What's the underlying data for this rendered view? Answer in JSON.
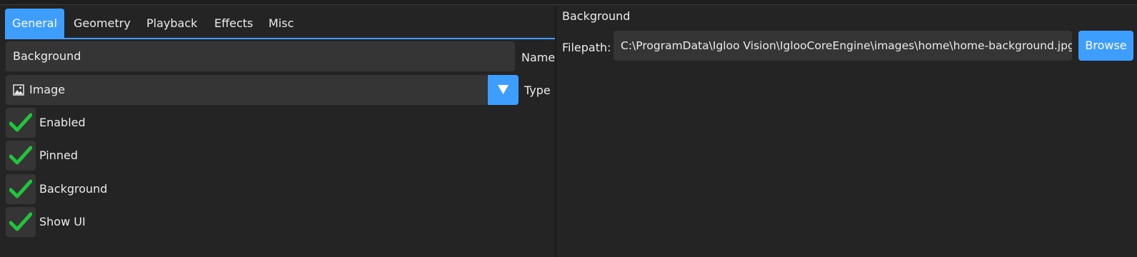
{
  "tabs": [
    {
      "label": "General",
      "active": true
    },
    {
      "label": "Geometry",
      "active": false
    },
    {
      "label": "Playback",
      "active": false
    },
    {
      "label": "Effects",
      "active": false
    },
    {
      "label": "Misc",
      "active": false
    }
  ],
  "general": {
    "name_value": "Background",
    "name_label": "Name",
    "type_value": "Image",
    "type_icon": "image-icon",
    "type_label": "Type",
    "checkboxes": [
      {
        "label": "Enabled",
        "checked": true
      },
      {
        "label": "Pinned",
        "checked": true
      },
      {
        "label": "Background",
        "checked": true
      },
      {
        "label": "Show UI",
        "checked": true
      }
    ]
  },
  "details": {
    "title": "Background",
    "filepath_label": "Filepath:",
    "filepath_value": "C:\\ProgramData\\Igloo Vision\\IglooCoreEngine\\images\\home\\home-background.jpg",
    "browse_label": "Browse"
  },
  "colors": {
    "accent": "#3d9eff",
    "check": "#22c33d",
    "background": "#242424",
    "field": "#353535"
  }
}
